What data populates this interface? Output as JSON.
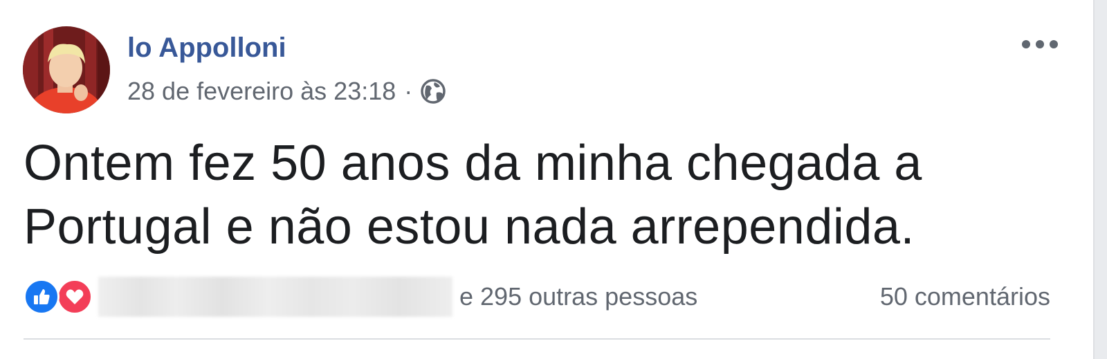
{
  "post": {
    "author_name": "lo Appolloni",
    "timestamp": "28 de fevereiro às 23:18",
    "separator": "·",
    "privacy_icon": "globe-icon",
    "more_icon": "ellipsis-icon",
    "text_line1": "Ontem fez 50 anos da minha chegada a",
    "text_line2": "Portugal e não estou nada arrependida."
  },
  "reactions": {
    "icons": [
      "like-icon",
      "love-icon"
    ],
    "others_text": "e 295 outras pessoas",
    "comments_text": "50 comentários"
  },
  "colors": {
    "author_link": "#385898",
    "meta_text": "#616770",
    "body_text": "#1c1e21",
    "like_blue": "#1877f2",
    "love_red": "#f33e58",
    "divider": "#dadde1"
  }
}
